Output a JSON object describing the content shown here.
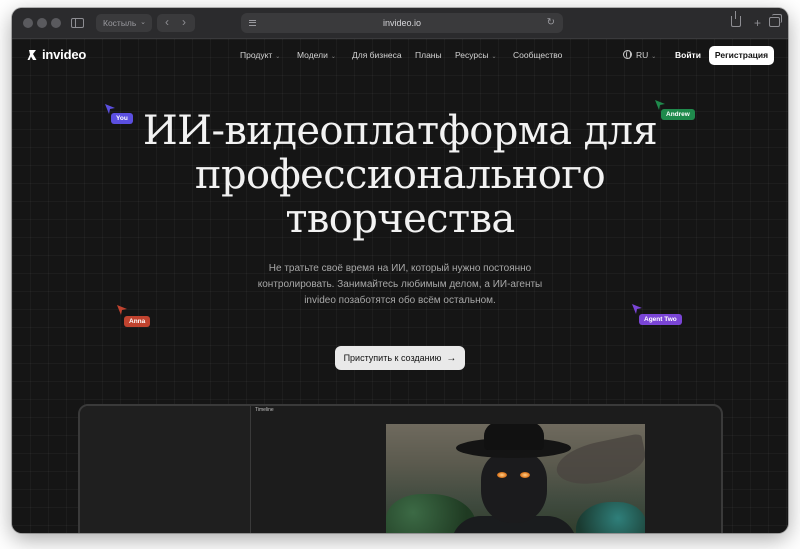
{
  "browser": {
    "tab_group_label": "Костыль",
    "url": "invideo.io"
  },
  "nav": {
    "brand": "invideo",
    "items": [
      {
        "label": "Продукт",
        "has_dropdown": true
      },
      {
        "label": "Модели",
        "has_dropdown": true
      },
      {
        "label": "Для бизнеса",
        "has_dropdown": false
      },
      {
        "label": "Планы",
        "has_dropdown": false
      },
      {
        "label": "Ресурсы",
        "has_dropdown": true
      },
      {
        "label": "Сообщество",
        "has_dropdown": false
      }
    ],
    "language": "RU",
    "login_label": "Войти",
    "signup_label": "Регистрация"
  },
  "hero": {
    "title_lines": [
      "ИИ-видеоплатформа для",
      "профессионального",
      "творчества"
    ],
    "subtitle_lines": [
      "Не тратьте своё время на ИИ, который нужно постоянно",
      "контролировать. Занимайтесь любимым делом, а ИИ-агенты",
      "invideo позаботятся обо всём остальном."
    ],
    "cta_label": "Приступить к созданию",
    "cta_icon": "arrow-right-icon"
  },
  "cursors": [
    {
      "name": "You",
      "color": "#5b4fe0"
    },
    {
      "name": "Andrew",
      "color": "#1f8a4c"
    },
    {
      "name": "Anna",
      "color": "#c0432f"
    },
    {
      "name": "Agent Two",
      "color": "#7a45d6"
    }
  ],
  "editor": {
    "timeline_label": "Timeline"
  },
  "colors": {
    "page_bg": "#151515",
    "chrome_bg": "#2b2b2d",
    "signup_bg": "#ffffff",
    "cta_bg": "#e9e9e9"
  }
}
